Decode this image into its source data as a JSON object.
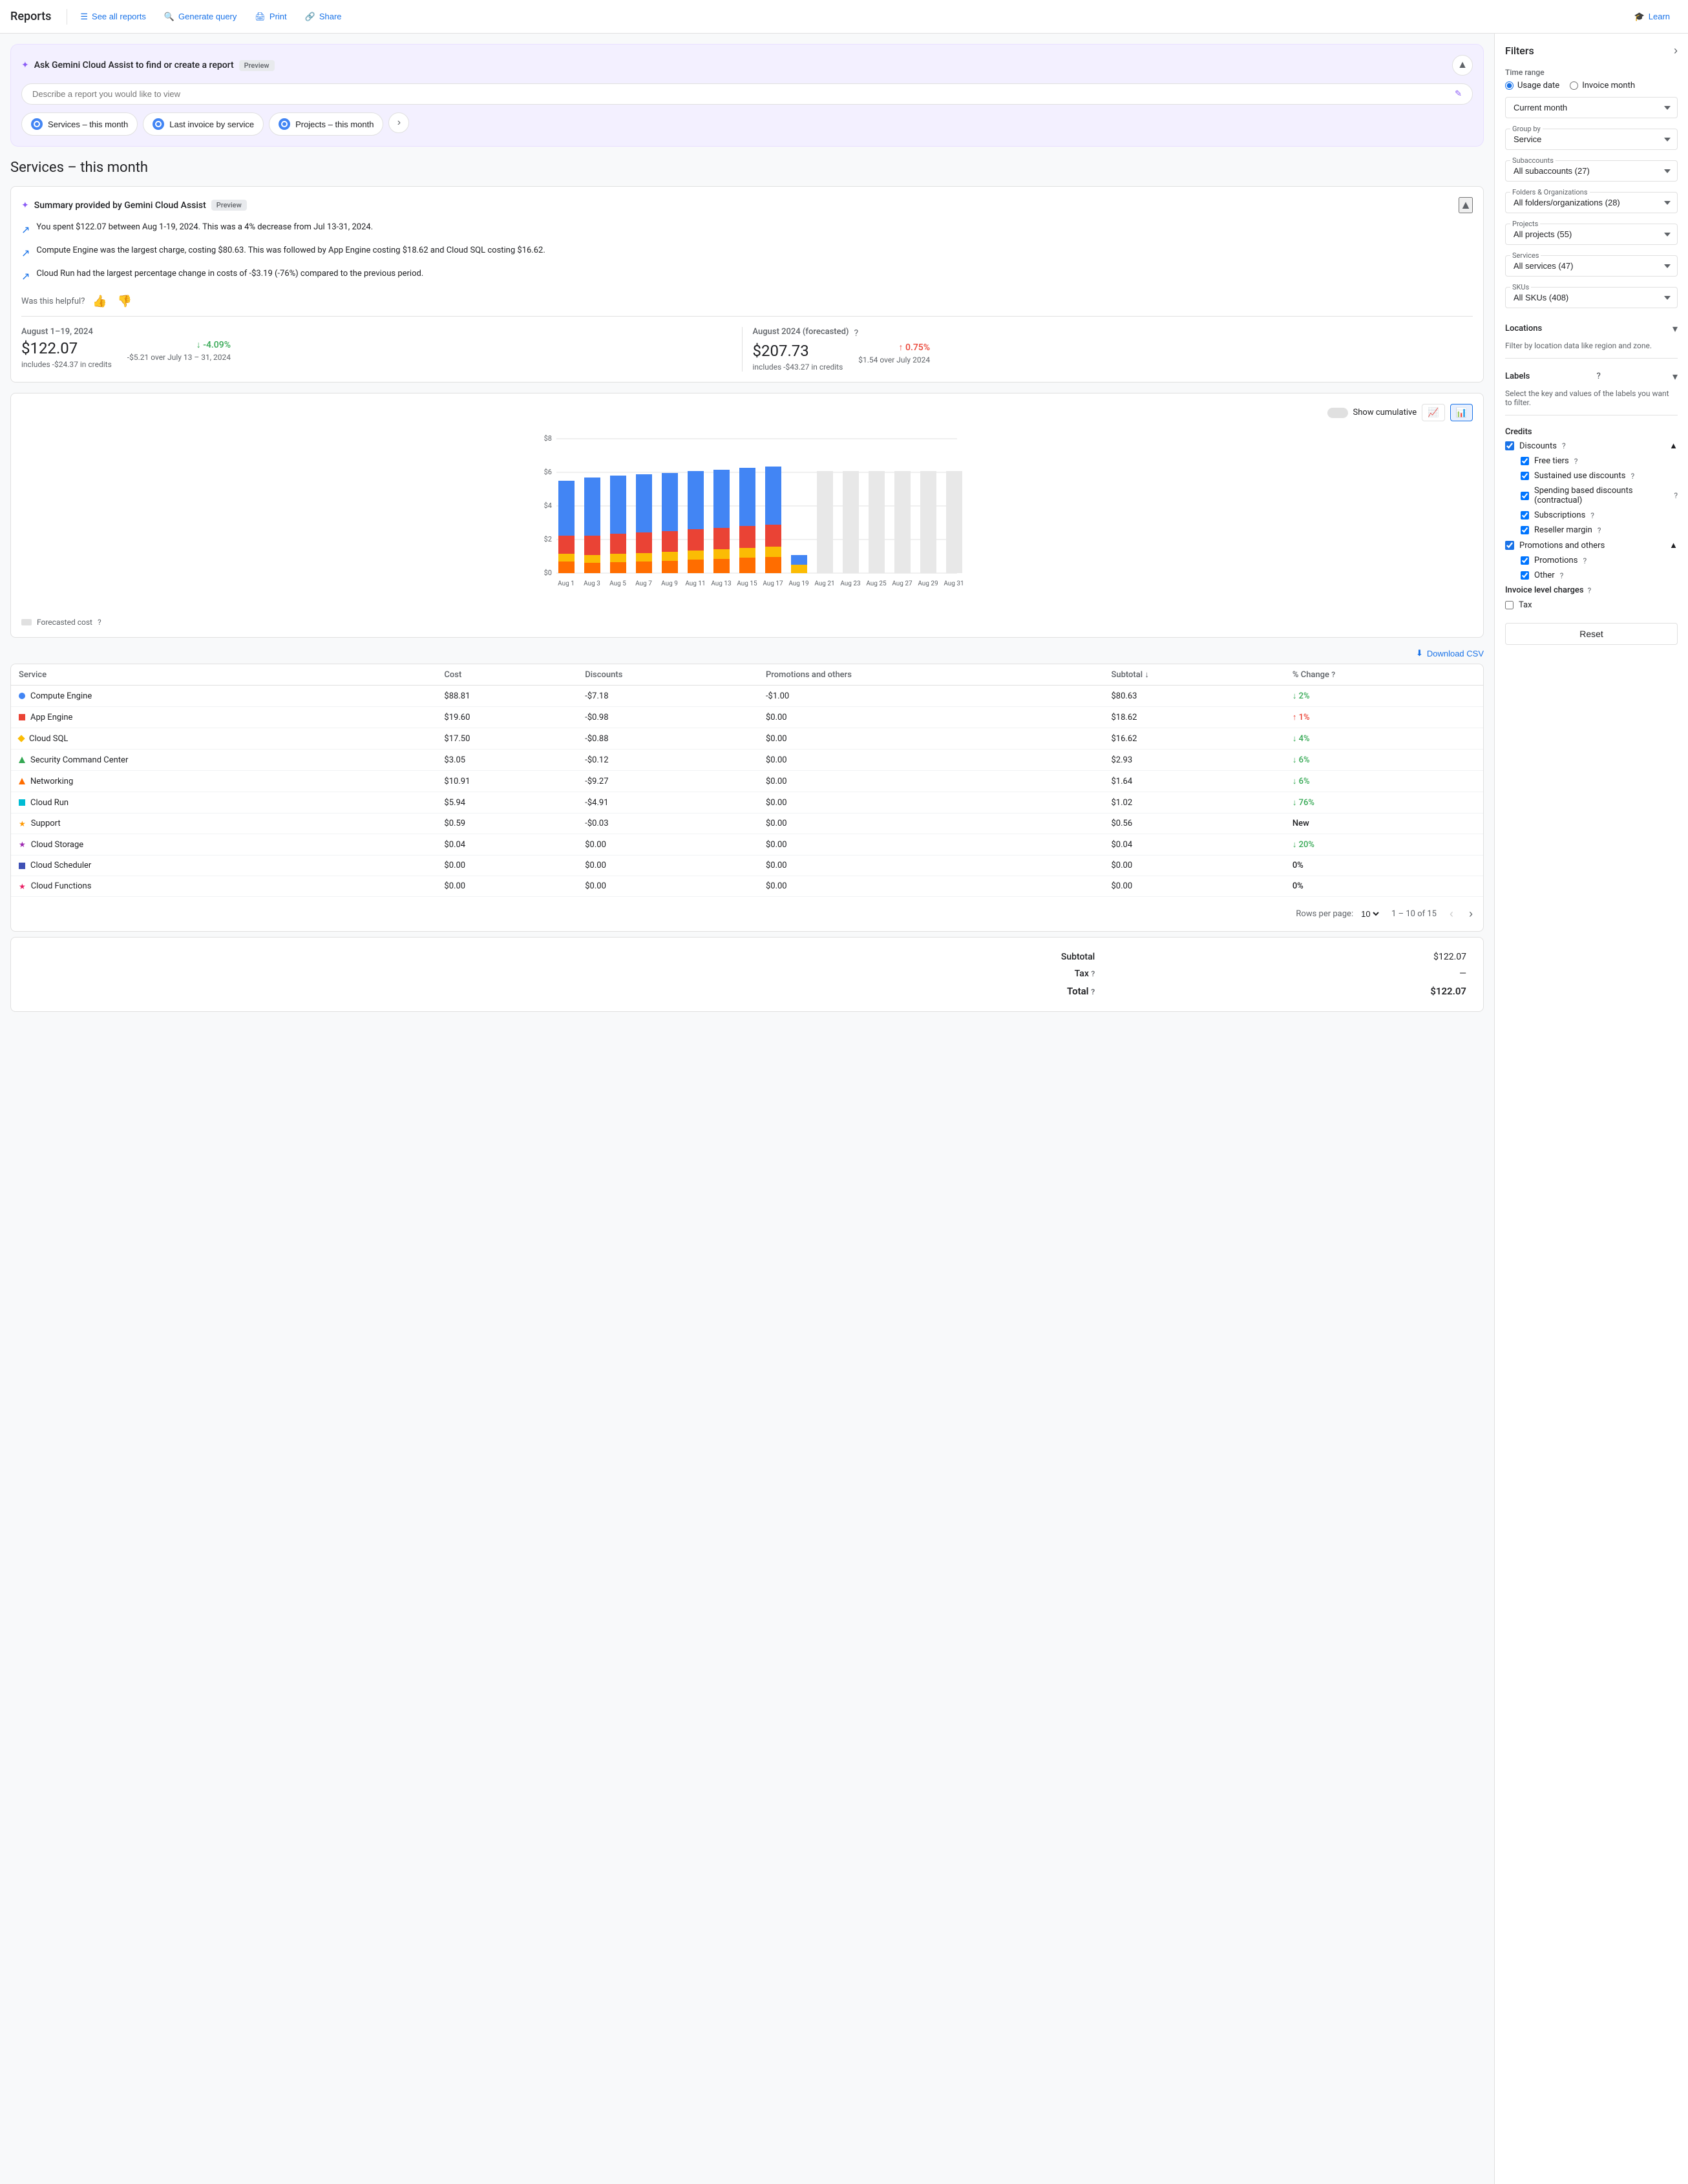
{
  "nav": {
    "title": "Reports",
    "see_all": "See all reports",
    "generate": "Generate query",
    "print": "Print",
    "share": "Share",
    "learn": "Learn"
  },
  "gemini": {
    "title": "Ask Gemini Cloud Assist to find or create a report",
    "preview_badge": "Preview",
    "placeholder": "Describe a report you would like to view",
    "quick_reports": [
      "Services – this month",
      "Last invoice by service",
      "Projects – this month"
    ]
  },
  "page_title": "Services – this month",
  "summary": {
    "title": "Summary provided by Gemini Cloud Assist",
    "preview_badge": "Preview",
    "items": [
      "You spent $122.07 between Aug 1-19, 2024. This was a 4% decrease from Jul 13-31, 2024.",
      "Compute Engine was the largest charge, costing $80.63. This was followed by App Engine costing $18.62 and Cloud SQL costing $16.62.",
      "Cloud Run had the largest percentage change in costs of -$3.19 (-76%) compared to the previous period."
    ],
    "feedback_prompt": "Was this helpful?"
  },
  "metrics": {
    "current": {
      "period": "August 1–19, 2024",
      "value": "$122.07",
      "sub": "includes -$24.37 in credits",
      "change": "↓ -4.09%",
      "change_type": "down",
      "change_sub": "-$5.21 over July 13 – 31, 2024"
    },
    "forecasted": {
      "period": "August 2024 (forecasted)",
      "value": "$207.73",
      "sub": "includes -$43.27 in credits",
      "change": "↑ 0.75%",
      "change_type": "up",
      "change_sub": "$1.54 over July 2024"
    }
  },
  "chart": {
    "y_label": "$8",
    "y_mid": "$6",
    "y_3": "$4",
    "y_2": "$2",
    "y_0": "$0",
    "x_labels": [
      "Aug 1",
      "Aug 3",
      "Aug 5",
      "Aug 7",
      "Aug 9",
      "Aug 11",
      "Aug 13",
      "Aug 15",
      "Aug 17",
      "Aug 19",
      "Aug 21",
      "Aug 23",
      "Aug 25",
      "Aug 27",
      "Aug 29",
      "Aug 31"
    ],
    "show_cumulative": "Show cumulative",
    "forecasted_cost": "Forecasted cost"
  },
  "download_btn": "Download CSV",
  "table": {
    "headers": [
      "Service",
      "Cost",
      "Discounts",
      "Promotions and others",
      "Subtotal",
      "% Change"
    ],
    "rows": [
      {
        "color": "#4285f4",
        "shape": "circle",
        "name": "Compute Engine",
        "cost": "$88.81",
        "discounts": "-$7.18",
        "promotions": "-$1.00",
        "subtotal": "$80.63",
        "change": "↓ 2%",
        "change_type": "down"
      },
      {
        "color": "#ea4335",
        "shape": "square",
        "name": "App Engine",
        "cost": "$19.60",
        "discounts": "-$0.98",
        "promotions": "$0.00",
        "subtotal": "$18.62",
        "change": "↑ 1%",
        "change_type": "up"
      },
      {
        "color": "#fbbc04",
        "shape": "diamond",
        "name": "Cloud SQL",
        "cost": "$17.50",
        "discounts": "-$0.88",
        "promotions": "$0.00",
        "subtotal": "$16.62",
        "change": "↓ 4%",
        "change_type": "down"
      },
      {
        "color": "#34a853",
        "shape": "triangle",
        "name": "Security Command Center",
        "cost": "$3.05",
        "discounts": "-$0.12",
        "promotions": "$0.00",
        "subtotal": "$2.93",
        "change": "↓ 6%",
        "change_type": "down"
      },
      {
        "color": "#ff6d00",
        "shape": "triangle",
        "name": "Networking",
        "cost": "$10.91",
        "discounts": "-$9.27",
        "promotions": "$0.00",
        "subtotal": "$1.64",
        "change": "↓ 6%",
        "change_type": "down"
      },
      {
        "color": "#00bcd4",
        "shape": "square",
        "name": "Cloud Run",
        "cost": "$5.94",
        "discounts": "-$4.91",
        "promotions": "$0.00",
        "subtotal": "$1.02",
        "change": "↓ 76%",
        "change_type": "down"
      },
      {
        "color": "#ff9800",
        "shape": "star",
        "name": "Support",
        "cost": "$0.59",
        "discounts": "-$0.03",
        "promotions": "$0.00",
        "subtotal": "$0.56",
        "change": "New",
        "change_type": "neutral"
      },
      {
        "color": "#9c27b0",
        "shape": "star",
        "name": "Cloud Storage",
        "cost": "$0.04",
        "discounts": "$0.00",
        "promotions": "$0.00",
        "subtotal": "$0.04",
        "change": "↓ 20%",
        "change_type": "down"
      },
      {
        "color": "#3f51b5",
        "shape": "square",
        "name": "Cloud Scheduler",
        "cost": "$0.00",
        "discounts": "$0.00",
        "promotions": "$0.00",
        "subtotal": "$0.00",
        "change": "0%",
        "change_type": "neutral"
      },
      {
        "color": "#e91e63",
        "shape": "star",
        "name": "Cloud Functions",
        "cost": "$0.00",
        "discounts": "$0.00",
        "promotions": "$0.00",
        "subtotal": "$0.00",
        "change": "0%",
        "change_type": "neutral"
      }
    ],
    "pagination": {
      "rows_per_page": "Rows per page:",
      "rows_count": "10",
      "range": "1 – 10 of 15"
    }
  },
  "totals": {
    "subtotal_label": "Subtotal",
    "subtotal_value": "$122.07",
    "tax_label": "Tax",
    "tax_value": "—",
    "total_label": "Total",
    "total_value": "$122.07"
  },
  "filters": {
    "title": "Filters",
    "time_range_label": "Time range",
    "usage_date": "Usage date",
    "invoice_month": "Invoice month",
    "current_month": "Current month",
    "group_by_label": "Group by",
    "group_by_value": "Service",
    "subaccounts_label": "Subaccounts",
    "subaccounts_value": "All subaccounts (27)",
    "folders_label": "Folders & Organizations",
    "folders_value": "All folders/organizations (28)",
    "projects_label": "Projects",
    "projects_value": "All projects (55)",
    "services_label": "Services",
    "services_value": "All services (47)",
    "skus_label": "SKUs",
    "skus_value": "All SKUs (408)",
    "locations_label": "Locations",
    "locations_desc": "Filter by location data like region and zone.",
    "labels_label": "Labels",
    "labels_desc": "Select the key and values of the labels you want to filter.",
    "credits_label": "Credits",
    "discounts_label": "Discounts",
    "free_tiers": "Free tiers",
    "sustained_discounts": "Sustained use discounts",
    "spending_based": "Spending based discounts (contractual)",
    "subscriptions": "Subscriptions",
    "reseller_margin": "Reseller margin",
    "promotions_label": "Promotions and others",
    "promotions": "Promotions",
    "other": "Other",
    "invoice_charges_label": "Invoice level charges",
    "tax_label2": "Tax",
    "reset_btn": "Reset"
  }
}
